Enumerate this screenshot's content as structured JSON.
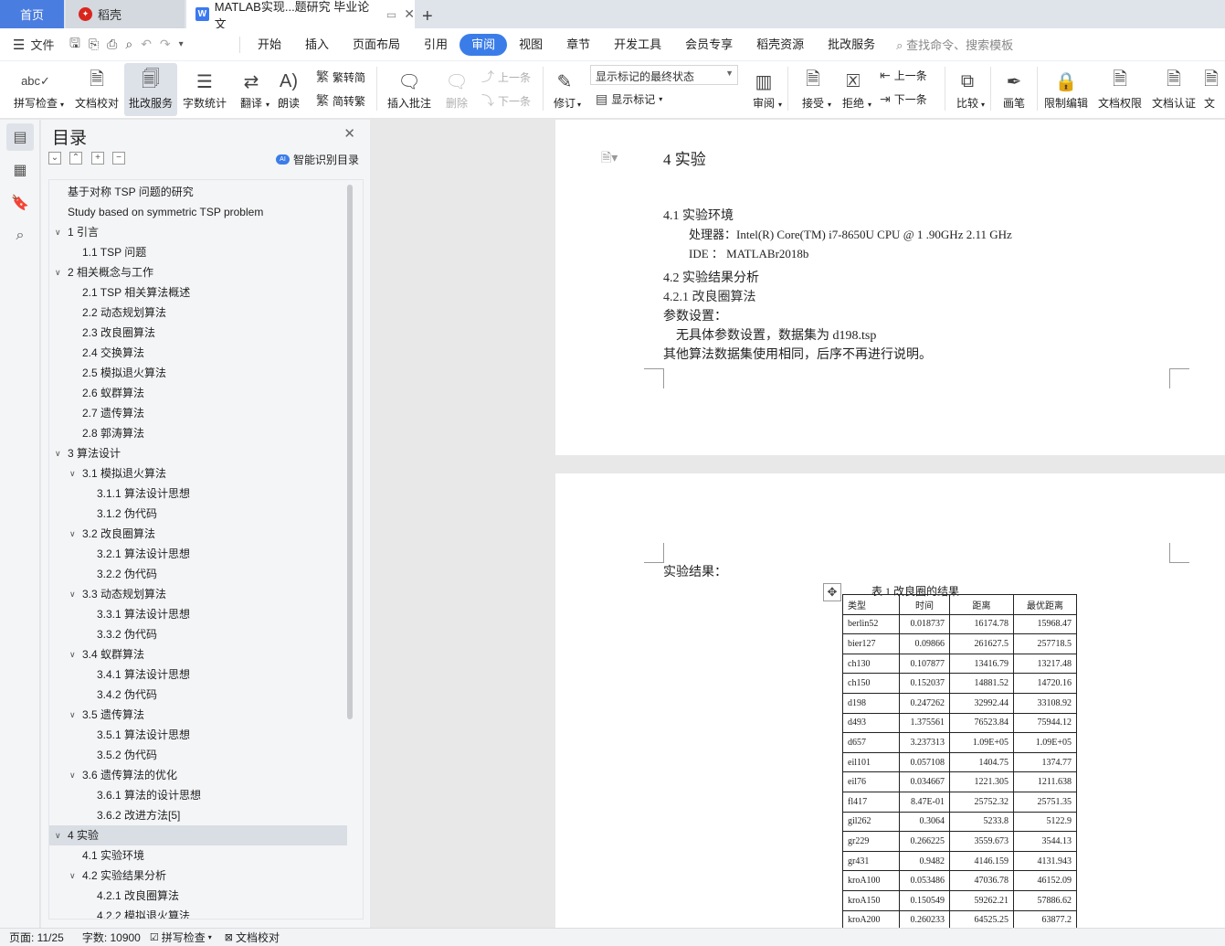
{
  "tabs": {
    "home": "首页",
    "daoke": "稻壳",
    "doc": "MATLAB实现...题研究 毕业论文"
  },
  "menu": {
    "file": "文件",
    "items": [
      "开始",
      "插入",
      "页面布局",
      "引用",
      "审阅",
      "视图",
      "章节",
      "开发工具",
      "会员专享",
      "稻壳资源",
      "批改服务"
    ],
    "active_index": 4,
    "search": "查找命令、搜索模板"
  },
  "ribbon": {
    "spell_check": "拼写检查",
    "doc_proof": "文档校对",
    "review_service": "批改服务",
    "word_count": "字数统计",
    "translate": "翻译",
    "read_aloud": "朗读",
    "to_traditional": "繁转简",
    "to_simplified": "简转繁",
    "insert_comment": "插入批注",
    "delete": "删除",
    "prev_comment": "上一条",
    "next_comment": "下一条",
    "markup_state": "显示标记的最终状态",
    "track_changes": "修订",
    "show_markup": "显示标记",
    "review": "审阅",
    "accept": "接受",
    "reject": "拒绝",
    "prev_change": "上一条",
    "next_change": "下一条",
    "compare": "比较",
    "pen": "画笔",
    "restrict_edit": "限制编辑",
    "doc_permission": "文档权限",
    "doc_certify": "文档认证",
    "doc_more": "文"
  },
  "toc": {
    "title": "目录",
    "smart": "智能识别目录",
    "items": [
      {
        "text": "基于对称 TSP 问题的研究",
        "level": 0,
        "chevron": false
      },
      {
        "text": "Study based on symmetric TSP problem",
        "level": 0,
        "chevron": false
      },
      {
        "text": "1  引言",
        "level": 0,
        "chevron": true
      },
      {
        "text": "1.1 TSP 问题",
        "level": 1,
        "chevron": false
      },
      {
        "text": "2  相关概念与工作",
        "level": 0,
        "chevron": true
      },
      {
        "text": "2.1 TSP 相关算法概述",
        "level": 1,
        "chevron": false
      },
      {
        "text": "2.2  动态规划算法",
        "level": 1,
        "chevron": false
      },
      {
        "text": "2.3  改良圈算法",
        "level": 1,
        "chevron": false
      },
      {
        "text": "2.4  交换算法",
        "level": 1,
        "chevron": false
      },
      {
        "text": "2.5  模拟退火算法",
        "level": 1,
        "chevron": false
      },
      {
        "text": "2.6  蚁群算法",
        "level": 1,
        "chevron": false
      },
      {
        "text": "2.7  遗传算法",
        "level": 1,
        "chevron": false
      },
      {
        "text": "2.8  郭涛算法",
        "level": 1,
        "chevron": false
      },
      {
        "text": "3  算法设计",
        "level": 0,
        "chevron": true
      },
      {
        "text": "3.1  模拟退火算法",
        "level": 1,
        "chevron": true
      },
      {
        "text": "3.1.1  算法设计思想",
        "level": 2,
        "chevron": false
      },
      {
        "text": "3.1.2  伪代码",
        "level": 2,
        "chevron": false
      },
      {
        "text": "3.2  改良圈算法",
        "level": 1,
        "chevron": true
      },
      {
        "text": "3.2.1  算法设计思想",
        "level": 2,
        "chevron": false
      },
      {
        "text": "3.2.2  伪代码",
        "level": 2,
        "chevron": false
      },
      {
        "text": "3.3  动态规划算法",
        "level": 1,
        "chevron": true
      },
      {
        "text": "3.3.1  算法设计思想",
        "level": 2,
        "chevron": false
      },
      {
        "text": "3.3.2  伪代码",
        "level": 2,
        "chevron": false
      },
      {
        "text": "3.4  蚁群算法",
        "level": 1,
        "chevron": true
      },
      {
        "text": "3.4.1  算法设计思想",
        "level": 2,
        "chevron": false
      },
      {
        "text": "3.4.2  伪代码",
        "level": 2,
        "chevron": false
      },
      {
        "text": "3.5  遗传算法",
        "level": 1,
        "chevron": true
      },
      {
        "text": "3.5.1  算法设计思想",
        "level": 2,
        "chevron": false
      },
      {
        "text": "3.5.2  伪代码",
        "level": 2,
        "chevron": false
      },
      {
        "text": "3.6  遗传算法的优化",
        "level": 1,
        "chevron": true
      },
      {
        "text": "3.6.1  算法的设计思想",
        "level": 2,
        "chevron": false
      },
      {
        "text": "3.6.2  改进方法[5]",
        "level": 2,
        "chevron": false
      },
      {
        "text": "4  实验",
        "level": 0,
        "chevron": true,
        "selected": true
      },
      {
        "text": "4.1  实验环境",
        "level": 1,
        "chevron": false
      },
      {
        "text": "4.2  实验结果分析",
        "level": 1,
        "chevron": true
      },
      {
        "text": "4.2.1  改良圈算法",
        "level": 2,
        "chevron": false
      },
      {
        "text": "4.2.2  模拟退火算法",
        "level": 2,
        "chevron": false
      }
    ]
  },
  "doc": {
    "page1": {
      "heading": "4  实验",
      "sec41": "4.1  实验环境",
      "cpu": "处理器：Intel(R) Core(TM) i7-8650U CPU @ 1 .90GHz 2.11 GHz",
      "ide": "IDE ： MATLABr2018b",
      "sec42": "4.2  实验结果分析",
      "sec421": "4.2.1  改良圈算法",
      "param_title": "参数设置：",
      "param_body": "无具体参数设置，数据集为 d198.tsp",
      "note": "其他算法数据集使用相同，后序不再进行说明。"
    },
    "page2": {
      "results_label": "实验结果：",
      "table_caption": "表 1  改良圈的结果",
      "table": {
        "headers": [
          "类型",
          "时间",
          "距离",
          "最优距离"
        ],
        "rows": [
          [
            "berlin52",
            "0.018737",
            "16174.78",
            "15968.47"
          ],
          [
            "bier127",
            "0.09866",
            "261627.5",
            "257718.5"
          ],
          [
            "ch130",
            "0.107877",
            "13416.79",
            "13217.48"
          ],
          [
            "ch150",
            "0.152037",
            "14881.52",
            "14720.16"
          ],
          [
            "d198",
            "0.247262",
            "32992.44",
            "33108.92"
          ],
          [
            "d493",
            "1.375561",
            "76523.84",
            "75944.12"
          ],
          [
            "d657",
            "3.237313",
            "1.09E+05",
            "1.09E+05"
          ],
          [
            "eil101",
            "0.057108",
            "1404.75",
            "1374.77"
          ],
          [
            "eil76",
            "0.034667",
            "1221.305",
            "1211.638"
          ],
          [
            "fl417",
            "8.47E-01",
            "25752.32",
            "25751.35"
          ],
          [
            "gil262",
            "0.3064",
            "5233.8",
            "5122.9"
          ],
          [
            "gr229",
            "0.266225",
            "3559.673",
            "3544.13"
          ],
          [
            "gr431",
            "0.9482",
            "4146.159",
            "4131.943"
          ],
          [
            "kroA100",
            "0.053486",
            "47036.78",
            "46152.09"
          ],
          [
            "kroA150",
            "0.150549",
            "59262.21",
            "57886.62"
          ],
          [
            "kroA200",
            "0.260233",
            "64525.25",
            "63877.2"
          ]
        ]
      }
    }
  },
  "status": {
    "page": "页面: 11/25",
    "words": "字数: 10900",
    "spell": "拼写检查",
    "proof": "文档校对"
  }
}
